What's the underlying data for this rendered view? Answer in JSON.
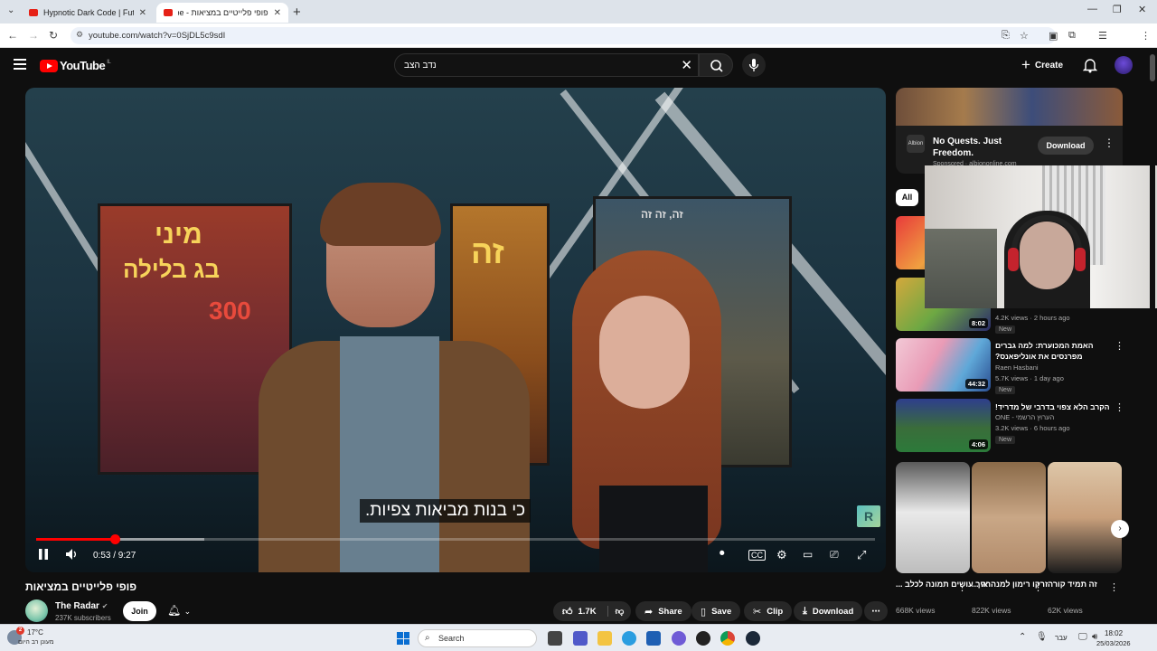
{
  "browser": {
    "tabs": [
      {
        "title": "Hypnotic Dark Code | Futuristic"
      },
      {
        "title": "פופי פלייטיים במציאות - YouTube"
      }
    ],
    "url": "youtube.com/watch?v=0SjDL5c9sdI"
  },
  "header": {
    "logo_text": "YouTube",
    "region": "IL",
    "search_value": "נדב הצב",
    "create_label": "Create"
  },
  "video": {
    "subtitle": "כי בנות מביאות צפיות.",
    "time_current": "0:53",
    "time_total": "9:27",
    "time_display": "0:53 / 9:27",
    "progress_fraction": 0.094,
    "buffered_fraction": 0.2,
    "watermark_letter": "R",
    "poster_texts": [
      "מיני",
      "בג בלילה",
      "300",
      "זה",
      "זה, זה זה"
    ]
  },
  "below": {
    "title": "פופי פלייטיים במציאות",
    "channel_name": "The Radar",
    "channel_subs": "237K subscribers",
    "join_label": "Join",
    "likes": "1.7K",
    "share_label": "Share",
    "save_label": "Save",
    "clip_label": "Clip",
    "download_label": "Download"
  },
  "sidebar": {
    "ad": {
      "title": "No Quests. Just Freedom.",
      "sponsored": "Sponsored · albiononline.com",
      "button": "Download",
      "logo_text": "Albion"
    },
    "chip_all": "All",
    "recs": [
      {
        "title": "",
        "meta1": "4.2K views · 2 hours ago",
        "badge": "New",
        "duration": "8:02"
      },
      {
        "title": "האמת המכוערת: למה גברים מפרנסים את אונליפאנס?",
        "channel": "Raen Hasbani",
        "meta1": "5.7K views · 1 day ago",
        "badge": "New",
        "duration": "44:32"
      },
      {
        "title": "הקרב הלא צפוי בדרבי של מדריד!",
        "channel": "ONE - הערוץ הרשמי",
        "meta1": "3.2K views · 6 hours ago",
        "badge": "New",
        "duration": "4:06"
      }
    ],
    "shorts": [
      {
        "title": "איך עושים תמונה לכלב ...",
        "views": "668K views"
      },
      {
        "title": "זרקו רימון למנהרה ...",
        "views": "822K views"
      },
      {
        "title": "זה תמיד קורה",
        "views": "62K views"
      }
    ]
  },
  "taskbar": {
    "temp": "17°C",
    "weather_desc": "מעונן רב היום",
    "notif_count": "2",
    "search_label": "Search",
    "lang": "עבר",
    "time": "18:02",
    "date": "25/03/2026"
  },
  "colors": {
    "yt_red": "#ff0000",
    "bg": "#0f0f0f",
    "pill": "#272727"
  }
}
